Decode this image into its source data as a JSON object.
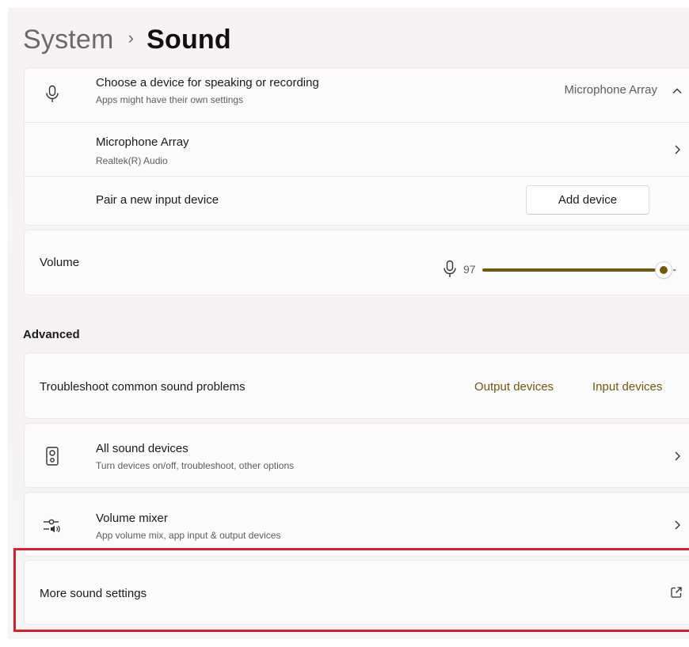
{
  "breadcrumb": {
    "parent": "System",
    "separator": "›",
    "current": "Sound"
  },
  "input_device": {
    "title": "Choose a device for speaking or recording",
    "subtitle": "Apps might have their own settings",
    "selected_value": "Microphone Array",
    "icon": "microphone-icon",
    "expanded": true
  },
  "device_item": {
    "title": "Microphone Array",
    "subtitle": "Realtek(R) Audio"
  },
  "pair_device": {
    "label": "Pair a new input device",
    "button_label": "Add device"
  },
  "volume": {
    "label": "Volume",
    "value_text": "97",
    "value": 97,
    "max": 100,
    "icon": "microphone-icon",
    "accent_color": "#6b5a10"
  },
  "advanced": {
    "heading": "Advanced",
    "troubleshoot": {
      "label": "Troubleshoot common sound problems",
      "output_link": "Output devices",
      "input_link": "Input devices"
    },
    "all_devices": {
      "title": "All sound devices",
      "subtitle": "Turn devices on/off, troubleshoot, other options",
      "icon": "speaker-icon"
    },
    "mixer": {
      "title": "Volume mixer",
      "subtitle": "App volume mix, app input & output devices",
      "icon": "volume-mixer-icon"
    },
    "more_settings": {
      "label": "More sound settings",
      "icon": "open-external-icon"
    }
  },
  "highlight_color": "#d3222d"
}
